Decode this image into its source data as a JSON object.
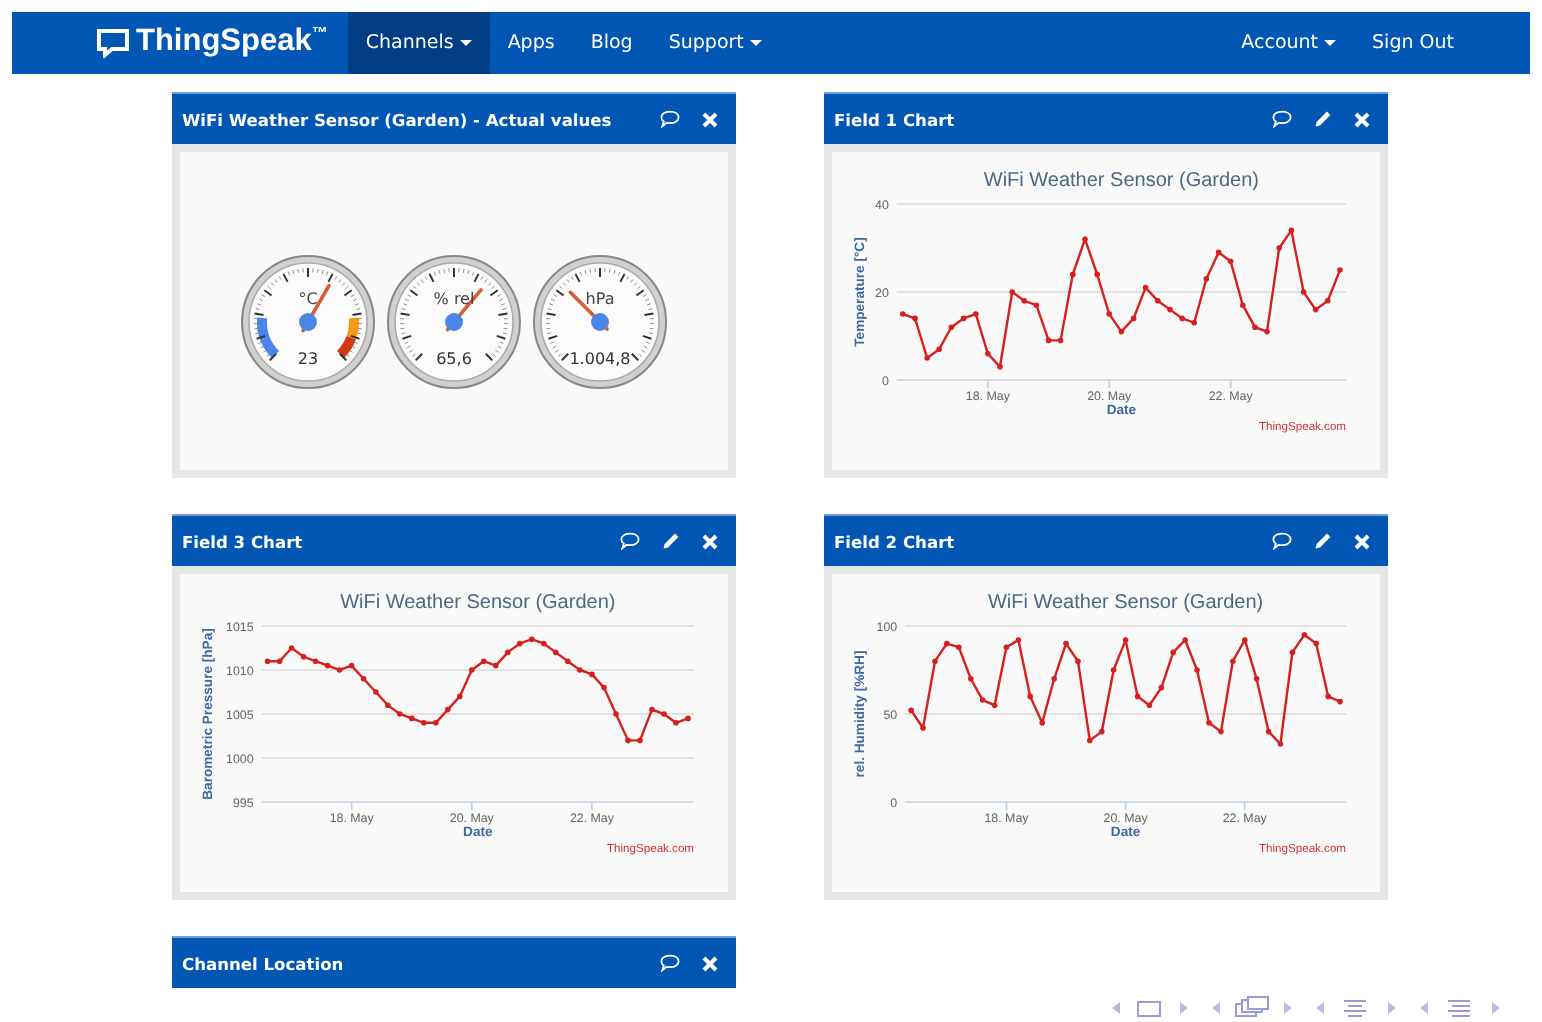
{
  "navbar": {
    "logo": "ThingSpeak$^{™}$",
    "items": [
      {
        "label": "Channels",
        "dropdown": true,
        "selected": true
      },
      {
        "label": "Apps",
        "dropdown": false,
        "selected": false
      },
      {
        "label": "Blog",
        "dropdown": false,
        "selected": false
      },
      {
        "label": "Support",
        "dropdown": true,
        "selected": false
      }
    ],
    "right_items": [
      {
        "label": "Account",
        "dropdown": true
      },
      {
        "label": "Sign Out",
        "dropdown": false
      }
    ]
  },
  "panels": [
    {
      "title": "WiFi Weather Sensor (Garden) - Actual values",
      "kind": "gauges",
      "editable": false,
      "gauges": [
        {
          "kind": "temperature",
          "unit": "°C",
          "value": "23"
        },
        {
          "kind": "humidity",
          "unit": "% rel",
          "value": "65,6"
        },
        {
          "kind": "pressure",
          "unit": "hPa",
          "value": "1.004,8"
        }
      ]
    },
    {
      "title": "Field 1 Chart",
      "kind": "chart",
      "editable": true,
      "credit": "ThingSpeak.com",
      "chart_data": {
        "type": "line",
        "title": "WiFi Weather Sensor (Garden)",
        "xlabel": "Date",
        "ylabel": "Temperature [°C]",
        "categories": [
          null,
          null,
          null,
          null,
          null,
          null,
          null,
          "18. May",
          null,
          null,
          null,
          null,
          null,
          null,
          null,
          null,
          null,
          "20. May",
          null,
          null,
          null,
          null,
          null,
          null,
          null,
          null,
          null,
          "22. May",
          null,
          null,
          null,
          null,
          null,
          null,
          null,
          null,
          null
        ],
        "series": [
          {
            "color": "#d62020",
            "values": [
              15,
              14,
              5,
              7,
              12,
              14,
              15,
              6,
              3,
              20,
              18,
              17,
              9,
              9,
              24,
              32,
              24,
              15,
              11,
              14,
              21,
              18,
              16,
              14,
              13,
              23,
              29,
              27,
              17,
              12,
              11,
              30,
              34,
              20,
              16,
              18,
              25
            ]
          }
        ],
        "ylim": [
          0,
          40
        ],
        "yticks": [
          0,
          20,
          40
        ],
        "grid": true
      }
    },
    {
      "title": "Field 3 Chart",
      "kind": "chart",
      "editable": true,
      "credit": "ThingSpeak.com",
      "chart_data": {
        "type": "line",
        "title": "WiFi Weather Sensor (Garden)",
        "xlabel": "Date",
        "ylabel": "Barometric Pressure [hPa]",
        "categories": [
          null,
          null,
          null,
          null,
          null,
          null,
          null,
          "18. May",
          null,
          null,
          null,
          null,
          null,
          null,
          null,
          null,
          null,
          "20. May",
          null,
          null,
          null,
          null,
          null,
          null,
          null,
          null,
          null,
          "22. May",
          null,
          null,
          null,
          null,
          null,
          null,
          null,
          null
        ],
        "series": [
          {
            "color": "#d62020",
            "values": [
              1011,
              1011,
              1012.5,
              1011.5,
              1011,
              1010.5,
              1010,
              1010.5,
              1009,
              1007.5,
              1006,
              1005,
              1004.5,
              1004,
              1004,
              1005.5,
              1007,
              1010,
              1011,
              1010.5,
              1012,
              1013,
              1013.5,
              1013,
              1012,
              1011,
              1010,
              1009.5,
              1008,
              1005,
              1002,
              1002,
              1005.5,
              1005,
              1004,
              1004.5
            ]
          }
        ],
        "ylim": [
          995,
          1015
        ],
        "yticks": [
          995,
          1000,
          1005,
          1010,
          1015
        ],
        "grid": true
      }
    },
    {
      "title": "Field 2 Chart",
      "kind": "chart",
      "editable": true,
      "credit": "ThingSpeak.com",
      "chart_data": {
        "type": "line",
        "title": "WiFi Weather Sensor (Garden)",
        "xlabel": "Date",
        "ylabel": "rel. Humidity [%RH]",
        "categories": [
          null,
          null,
          null,
          null,
          null,
          null,
          null,
          null,
          "18. May",
          null,
          null,
          null,
          null,
          null,
          null,
          null,
          null,
          null,
          "20. May",
          null,
          null,
          null,
          null,
          null,
          null,
          null,
          null,
          null,
          "22. May",
          null,
          null,
          null,
          null,
          null,
          null,
          null,
          null
        ],
        "series": [
          {
            "color": "#d62020",
            "values": [
              52,
              42,
              80,
              90,
              88,
              70,
              58,
              55,
              88,
              92,
              60,
              45,
              70,
              90,
              80,
              35,
              40,
              75,
              92,
              60,
              55,
              65,
              85,
              92,
              75,
              45,
              40,
              80,
              92,
              70,
              40,
              33,
              85,
              95,
              90,
              60,
              57
            ]
          }
        ],
        "ylim": [
          0,
          100
        ],
        "yticks": [
          0,
          50,
          100
        ],
        "grid": true
      }
    },
    {
      "title": "Channel Location",
      "kind": "location",
      "editable": false
    }
  ]
}
